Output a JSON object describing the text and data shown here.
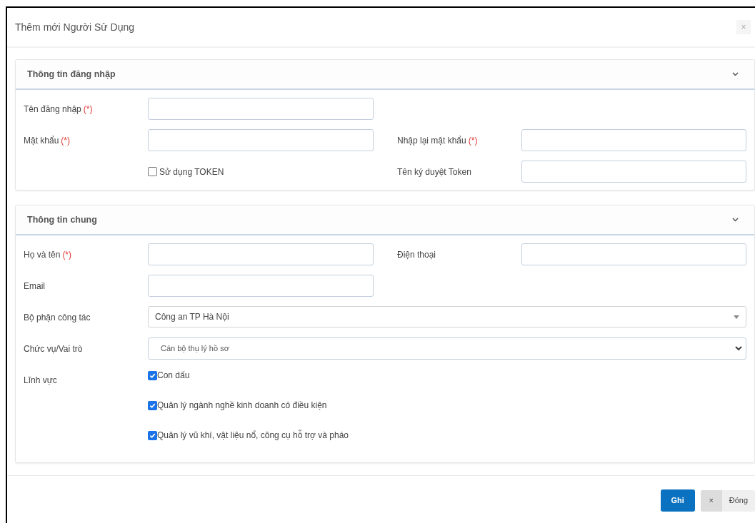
{
  "dialog": {
    "title": "Thêm mới Người Sử Dụng",
    "close": "×"
  },
  "sections": [
    {
      "title": "Thông tin đăng nhập",
      "expanded": true,
      "rows": [
        [
          {
            "label": "Tên đăng nhập",
            "required": "(*)",
            "control": {
              "kind": "text"
            }
          }
        ],
        [
          {
            "label": "Mật khẩu",
            "required": "(*)",
            "control": {
              "kind": "text"
            }
          },
          {
            "label": "Nhập lại mật khẩu",
            "required": "(*)",
            "control": {
              "kind": "text"
            }
          }
        ],
        [
          {
            "control": {
              "kind": "checkbox",
              "text": "Sử dụng TOKEN",
              "checked": false
            }
          },
          {
            "label": "Tên ký duyệt Token",
            "control": {
              "kind": "text"
            }
          }
        ]
      ]
    },
    {
      "title": "Thông tin chung",
      "expanded": true,
      "rows": [
        [
          {
            "label": "Họ và tên",
            "required": "(*)",
            "control": {
              "kind": "text"
            }
          },
          {
            "label": "Điện thoại",
            "control": {
              "kind": "text"
            }
          }
        ],
        [
          {
            "label": "Email",
            "control": {
              "kind": "text"
            }
          }
        ],
        [
          {
            "label": "Bộ phận công tác",
            "control": {
              "kind": "combobox",
              "value": "Công an TP Hà Nội"
            }
          }
        ],
        [
          {
            "label": "Chức vụ/Vai trò",
            "control": {
              "kind": "select",
              "value": "Cán bộ thụ lý hồ sơ"
            }
          }
        ],
        [
          {
            "label": "Lĩnh vực",
            "control": {
              "kind": "checklist",
              "options": [
                {
                  "text": "Con dấu",
                  "checked": true
                },
                {
                  "text": "Quản lý ngành nghề kinh doanh có điều kiện",
                  "checked": true
                },
                {
                  "text": "Quản lý vũ khí, vật liệu nổ, công cụ hỗ trợ và pháo",
                  "checked": true
                }
              ]
            }
          }
        ]
      ]
    }
  ],
  "footer": {
    "save": "Ghi",
    "close_icon": "×",
    "close": "Đóng"
  }
}
